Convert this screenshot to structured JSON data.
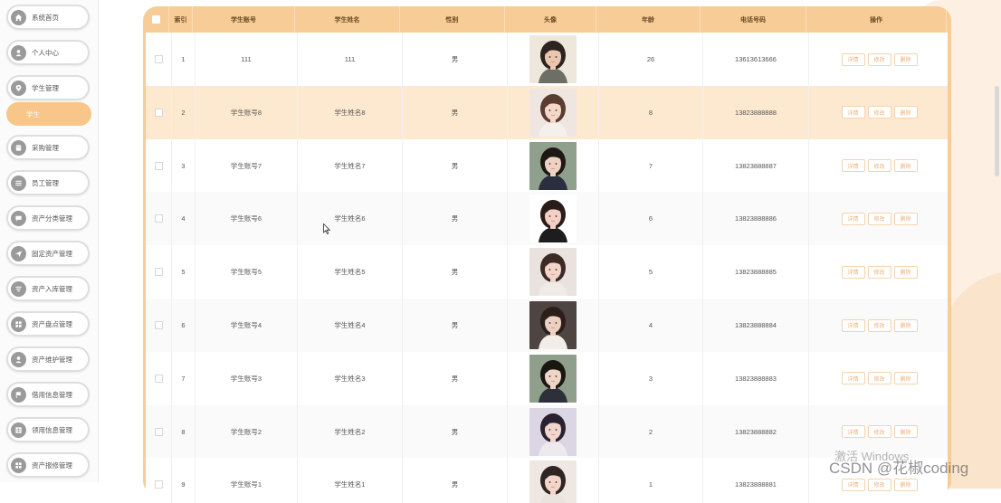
{
  "sidebar": {
    "items": [
      {
        "label": "系统首页",
        "icon": "home-icon"
      },
      {
        "label": "个人中心",
        "icon": "user-icon"
      },
      {
        "label": "学生管理",
        "icon": "location-icon"
      },
      {
        "label": "采购管理",
        "icon": "shop-icon"
      },
      {
        "label": "员工管理",
        "icon": "list-icon"
      },
      {
        "label": "资产分类管理",
        "icon": "chat-icon"
      },
      {
        "label": "固定资产管理",
        "icon": "send-icon"
      },
      {
        "label": "资产入库管理",
        "icon": "filter-icon"
      },
      {
        "label": "资产盘点管理",
        "icon": "grid-icon"
      },
      {
        "label": "资产维护管理",
        "icon": "user-icon"
      },
      {
        "label": "借用信息管理",
        "icon": "flag-icon"
      },
      {
        "label": "领用信息管理",
        "icon": "table-icon"
      },
      {
        "label": "资产报修管理",
        "icon": "grid-icon"
      }
    ],
    "active_sub": {
      "label": "学生"
    }
  },
  "table": {
    "headers": {
      "index": "索引",
      "account": "学生账号",
      "name": "学生姓名",
      "gender": "性别",
      "avatar": "头像",
      "age": "年龄",
      "phone": "电话号码",
      "ops": "操作"
    },
    "rows": [
      {
        "index": "1",
        "account": "111",
        "name": "111",
        "gender": "男",
        "age": "26",
        "phone": "13613613666"
      },
      {
        "index": "2",
        "account": "学生账号8",
        "name": "学生姓名8",
        "gender": "男",
        "age": "8",
        "phone": "13823888888"
      },
      {
        "index": "3",
        "account": "学生账号7",
        "name": "学生姓名7",
        "gender": "男",
        "age": "7",
        "phone": "13823888887"
      },
      {
        "index": "4",
        "account": "学生账号6",
        "name": "学生姓名6",
        "gender": "男",
        "age": "6",
        "phone": "13823888886"
      },
      {
        "index": "5",
        "account": "学生账号5",
        "name": "学生姓名5",
        "gender": "男",
        "age": "5",
        "phone": "13823888885"
      },
      {
        "index": "6",
        "account": "学生账号4",
        "name": "学生姓名4",
        "gender": "男",
        "age": "4",
        "phone": "13823888884"
      },
      {
        "index": "7",
        "account": "学生账号3",
        "name": "学生姓名3",
        "gender": "男",
        "age": "3",
        "phone": "13823888883"
      },
      {
        "index": "8",
        "account": "学生账号2",
        "name": "学生姓名2",
        "gender": "男",
        "age": "2",
        "phone": "13823888882"
      },
      {
        "index": "9",
        "account": "学生账号1",
        "name": "学生姓名1",
        "gender": "男",
        "age": "1",
        "phone": "13823888881"
      }
    ],
    "actions": {
      "detail": "详情",
      "edit": "修改",
      "delete": "删除"
    }
  },
  "overlay": {
    "activate_windows": "激活 Windows",
    "csdn_watermark": "CSDN @花椒coding"
  },
  "colors": {
    "accent": "#f8cc96",
    "active_menu": "#f7c688",
    "row_highlight": "#fde8d0",
    "button_text": "#e9b27a"
  }
}
